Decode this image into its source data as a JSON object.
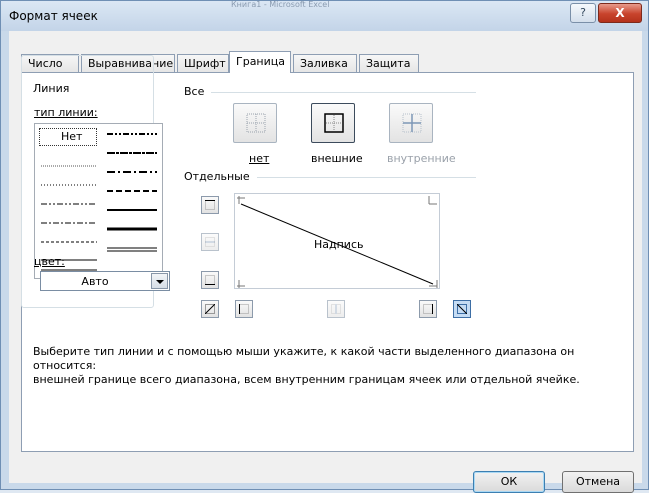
{
  "window": {
    "title": "Формат ячеек",
    "ghost_title": "Книга1 - Microsoft Excel",
    "help_label": "?",
    "close_label": "X"
  },
  "tabs": [
    {
      "label": "Число",
      "active": false
    },
    {
      "label": "Выравнивание",
      "active": false
    },
    {
      "label": "Шрифт",
      "active": false
    },
    {
      "label": "Граница",
      "active": true
    },
    {
      "label": "Заливка",
      "active": false
    },
    {
      "label": "Защита",
      "active": false
    }
  ],
  "line_group": {
    "title": "Линия",
    "style_label": "тип линии:",
    "none_style_label": "Нет",
    "selected_style": "Нет",
    "styles_left": [
      "none",
      "hair",
      "dotted",
      "dash-dot-dot",
      "dash-dot",
      "dashed",
      "thin",
      "double"
    ],
    "styles_right": [
      "medium-dash-dot-dot",
      "slanted-dash-dot",
      "medium-dash-dot",
      "medium-dashed",
      "medium",
      "thick",
      "double"
    ],
    "color_label": "цвет:",
    "color_value": "Авто"
  },
  "presets": {
    "title": "Все",
    "items": [
      {
        "label": "нет",
        "icon": "border-none-icon",
        "enabled": true
      },
      {
        "label": "внешние",
        "icon": "border-outline-icon",
        "enabled": true
      },
      {
        "label": "внутренние",
        "icon": "border-inside-icon",
        "enabled": false
      }
    ]
  },
  "borders": {
    "title": "Отдельные",
    "preview_text": "Надпись",
    "diagonal_down_active": true,
    "buttons": [
      "border-top",
      "border-middle-horizontal",
      "border-bottom",
      "border-diagonal-up",
      "border-left",
      "border-middle-vertical",
      "border-right",
      "border-diagonal-down"
    ]
  },
  "hint": {
    "line1": "Выберите тип линии и с помощью мыши укажите, к какой части выделенного диапазона он относится:",
    "line2": "внешней границе всего диапазона, всем внутренним границам ячеек или отдельной ячейке."
  },
  "buttons": {
    "ok": "ОК",
    "cancel": "Отмена"
  },
  "colors": {
    "accent": "#3d6ea5",
    "panel": "#ffffff",
    "frame": "#c9d9ea"
  }
}
